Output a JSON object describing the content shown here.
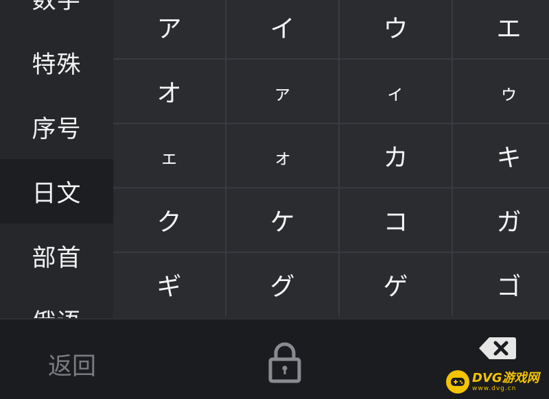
{
  "sidebar": {
    "categories": [
      {
        "label": "数字"
      },
      {
        "label": "特殊"
      },
      {
        "label": "序号"
      },
      {
        "label": "日文"
      },
      {
        "label": "部首"
      },
      {
        "label": "俄语"
      }
    ],
    "active_index": 3
  },
  "keys": [
    {
      "char": "ア",
      "size": "big"
    },
    {
      "char": "イ",
      "size": "big"
    },
    {
      "char": "ウ",
      "size": "big"
    },
    {
      "char": "エ",
      "size": "big"
    },
    {
      "char": "オ",
      "size": "big"
    },
    {
      "char": "ァ",
      "size": "small"
    },
    {
      "char": "ィ",
      "size": "small"
    },
    {
      "char": "ゥ",
      "size": "small"
    },
    {
      "char": "ェ",
      "size": "small"
    },
    {
      "char": "ォ",
      "size": "small"
    },
    {
      "char": "カ",
      "size": "big"
    },
    {
      "char": "キ",
      "size": "big"
    },
    {
      "char": "ク",
      "size": "big"
    },
    {
      "char": "ケ",
      "size": "big"
    },
    {
      "char": "コ",
      "size": "big"
    },
    {
      "char": "ガ",
      "size": "big"
    },
    {
      "char": "ギ",
      "size": "big"
    },
    {
      "char": "グ",
      "size": "big"
    },
    {
      "char": "ゲ",
      "size": "big"
    },
    {
      "char": "ゴ",
      "size": "big"
    }
  ],
  "bottom_bar": {
    "return_label": "返回",
    "lock_icon": "lock-icon",
    "delete_icon": "backspace-icon"
  },
  "watermark": {
    "main": "DVG游戏网",
    "sub": "www.dvg.cn"
  },
  "colors": {
    "background": "#1e1f22",
    "sidebar": "#26272b",
    "key": "#2b2c30",
    "accent": "#f5c400"
  }
}
